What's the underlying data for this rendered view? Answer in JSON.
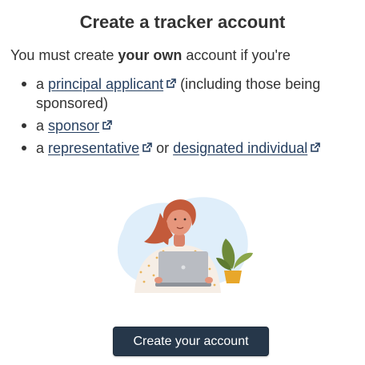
{
  "heading": "Create a tracker account",
  "intro": {
    "before": "You must create ",
    "emphasis": "your own",
    "after": " account if you're"
  },
  "roles": [
    {
      "prefix": "a ",
      "link": "principal applicant",
      "suffix": " (including those being sponsored)"
    },
    {
      "prefix": "a ",
      "link": "sponsor",
      "suffix": ""
    },
    {
      "prefix": "a ",
      "link": "representative",
      "middle": " or ",
      "link2": "designated individual"
    }
  ],
  "icons": {
    "external_link": "external-link-icon",
    "illustration": "woman-at-laptop-illustration"
  },
  "button": {
    "label": "Create your account"
  },
  "colors": {
    "link": "#284162",
    "button_bg": "#26374a",
    "button_text": "#ffffff",
    "text": "#333333"
  }
}
